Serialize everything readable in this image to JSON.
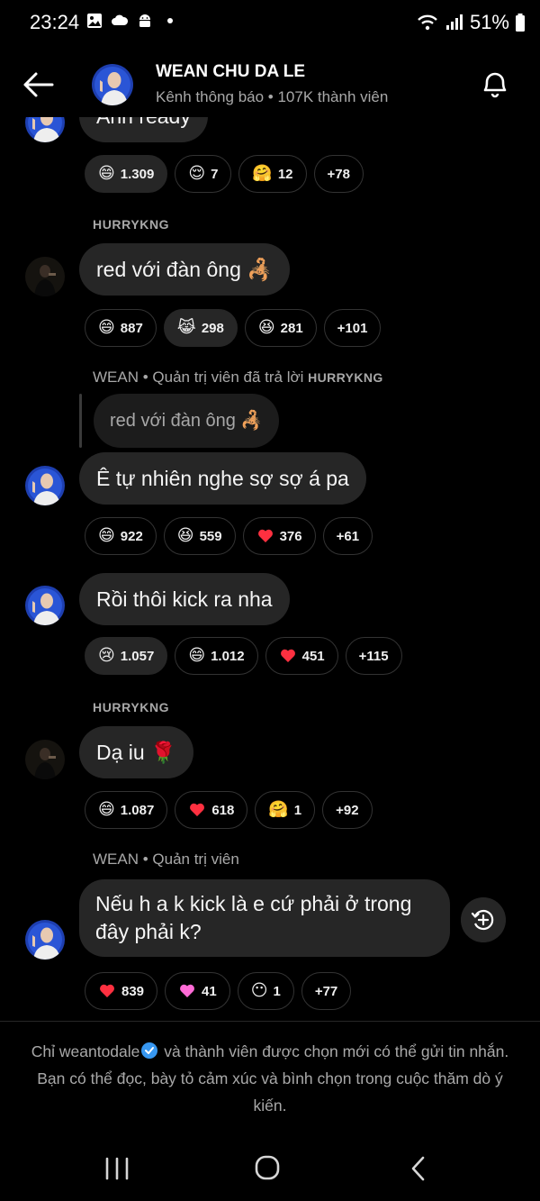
{
  "status": {
    "time": "23:24",
    "battery": "51%"
  },
  "header": {
    "title": "WEAN CHU DA LE",
    "subtitle": "Kênh thông báo • 107K thành viên"
  },
  "messages": [
    {
      "text": "Anh ready",
      "reactions": [
        "1.309",
        "7",
        "12",
        "+78"
      ]
    },
    {
      "sender": "HURRYKNG",
      "text": "red với đàn ông 🦂",
      "reactions": [
        "887",
        "298",
        "281",
        "+101"
      ]
    },
    {
      "meta_prefix": "WEAN • Quản trị viên đã trả lời",
      "meta_target": "HURRYKNG",
      "quoted": "red với đàn ông 🦂",
      "text": "Ê tự nhiên nghe sợ sợ á pa",
      "reactions": [
        "922",
        "559",
        "376",
        "+61"
      ]
    },
    {
      "text": "Rồi thôi kick ra nha",
      "reactions": [
        "1.057",
        "1.012",
        "451",
        "+115"
      ]
    },
    {
      "sender": "HURRYKNG",
      "text": "Dạ iu 🌹",
      "reactions": [
        "1.087",
        "618",
        "1",
        "+92"
      ]
    },
    {
      "meta": "WEAN • Quản trị viên",
      "text": "Nếu h a k kick là e cứ phải ở trong đây phải k?",
      "reactions": [
        "839",
        "41",
        "1",
        "+77"
      ]
    }
  ],
  "footer": {
    "before": "Chỉ weantodale",
    "after": " và thành viên được chọn mới có thể gửi tin nhắn. Bạn có thể đọc, bày tỏ cảm xúc và bình chọn trong cuộc thăm dò ý kiến."
  },
  "colors": {
    "background": "#000000",
    "bubble": "#262626",
    "muted_text": "#a8a8a8",
    "verified": "#3797f0",
    "heart": "#ff3040"
  },
  "icons": [
    "back-arrow-icon",
    "bell-icon",
    "forward-icon",
    "verified-badge-icon",
    "recents-icon",
    "home-icon",
    "back-nav-icon"
  ]
}
